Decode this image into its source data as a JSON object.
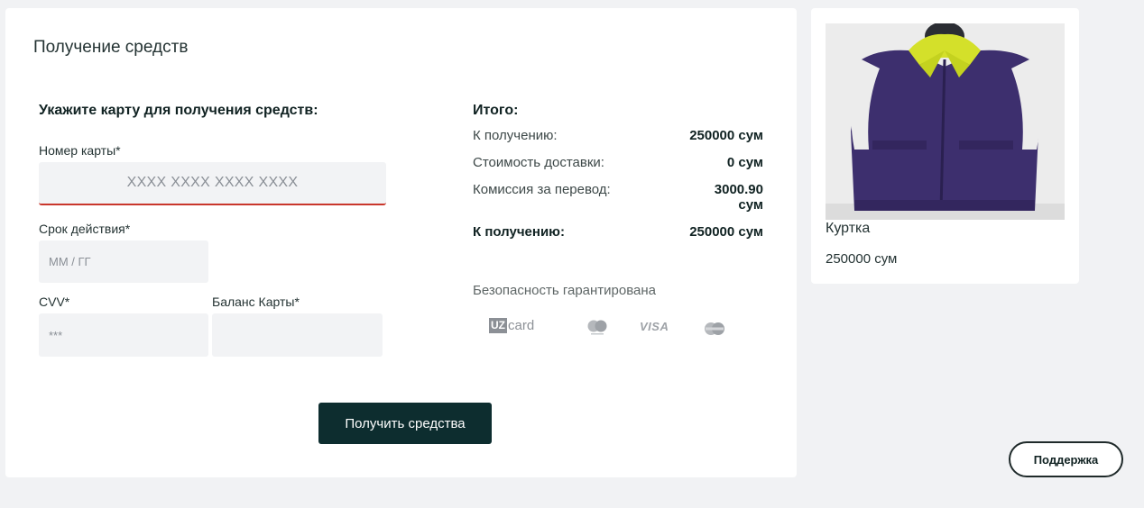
{
  "page": {
    "title": "Получение средств"
  },
  "form": {
    "section_title": "Укажите карту для получения средств:",
    "card_number_label": "Номер карты*",
    "card_number_placeholder": "XXXX XXXX XXXX XXXX",
    "expiry_label": "Срок действия*",
    "expiry_placeholder": "ММ / ГГ",
    "cvv_label": "CVV*",
    "cvv_placeholder": "***",
    "balance_label": "Баланс Карты*",
    "balance_placeholder": "",
    "submit_label": "Получить средства"
  },
  "summary": {
    "title": "Итого:",
    "rows": [
      {
        "label": "К получению:",
        "value": "250000 сум"
      },
      {
        "label": "Стоимость доставки:",
        "value": "0 сум"
      },
      {
        "label": "Комиссия за перевод:",
        "value": "3000.90 сум"
      }
    ],
    "total_label": "К получению:",
    "total_value": "250000 сум",
    "security_text": "Безопасность гарантирована"
  },
  "payment_logos": {
    "uzcard_box": "UZ",
    "uzcard_text": "card",
    "visa_text": "VISA",
    "icons": [
      "uzcard-logo",
      "mastercard-logo",
      "visa-logo",
      "maestro-logo"
    ],
    "logo_color": "#8c9096"
  },
  "product": {
    "name": "Куртка",
    "price": "250000 сум",
    "image_icon": "vest-jacket-image",
    "colors": {
      "body": "#3d2f6e",
      "collar": "#d4e02a",
      "background": "#efefef"
    }
  },
  "support": {
    "label": "Поддержка"
  },
  "colors": {
    "accent_dark": "#0d2d2f",
    "error_underline": "#c9362b",
    "field_bg": "#f2f3f5",
    "page_bg": "#f1f2f4"
  }
}
